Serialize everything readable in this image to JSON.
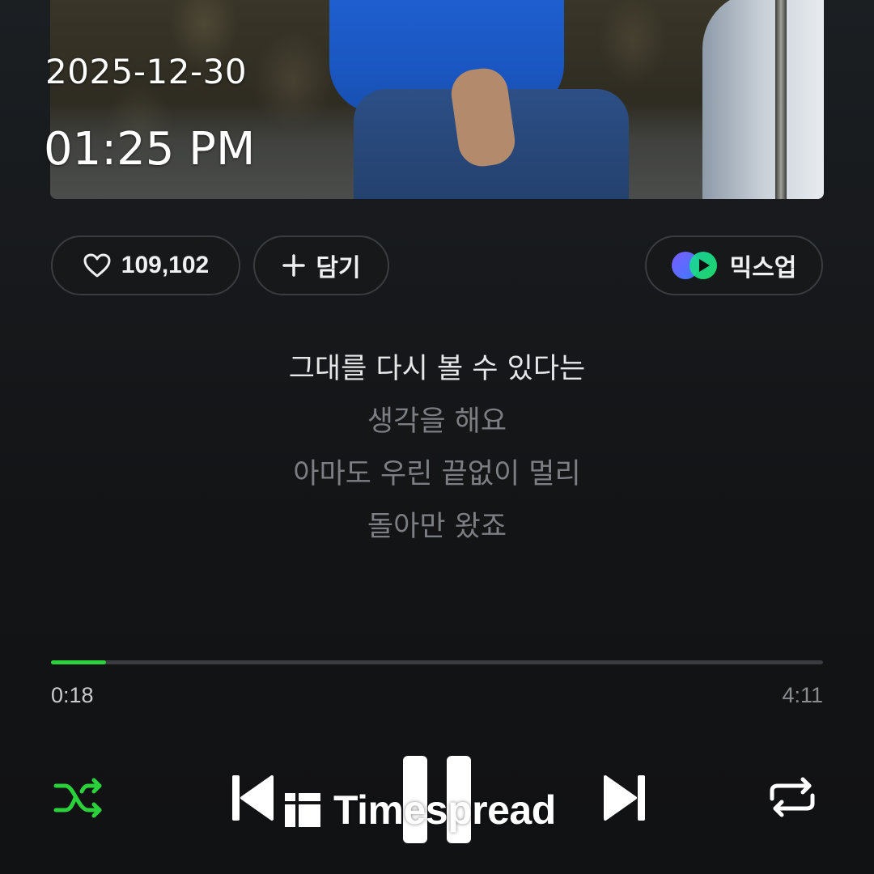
{
  "status": {
    "date": "2025-12-30",
    "time": "01:25 PM"
  },
  "actions": {
    "like_count": "109,102",
    "add_label": "담기",
    "mixup_label": "믹스업"
  },
  "lyrics": {
    "lines": [
      "그대를 다시 볼 수 있다는",
      "생각을 해요",
      "아마도 우린 끝없이 멀리",
      "돌아만 왔죠"
    ],
    "current_index": 0
  },
  "playback": {
    "elapsed": "0:18",
    "total": "4:11",
    "progress_fraction": 0.0717,
    "shuffle_on": true,
    "is_playing": true
  },
  "controls": {
    "shuffle_icon": "shuffle-icon",
    "prev_icon": "skip-previous-icon",
    "pause_icon": "pause-icon",
    "next_icon": "skip-next-icon",
    "repeat_icon": "repeat-icon"
  },
  "colors": {
    "accent": "#2bd13a",
    "background": "#121315",
    "pill_border": "#3a3d40"
  },
  "watermark": {
    "text": "Timespread"
  }
}
